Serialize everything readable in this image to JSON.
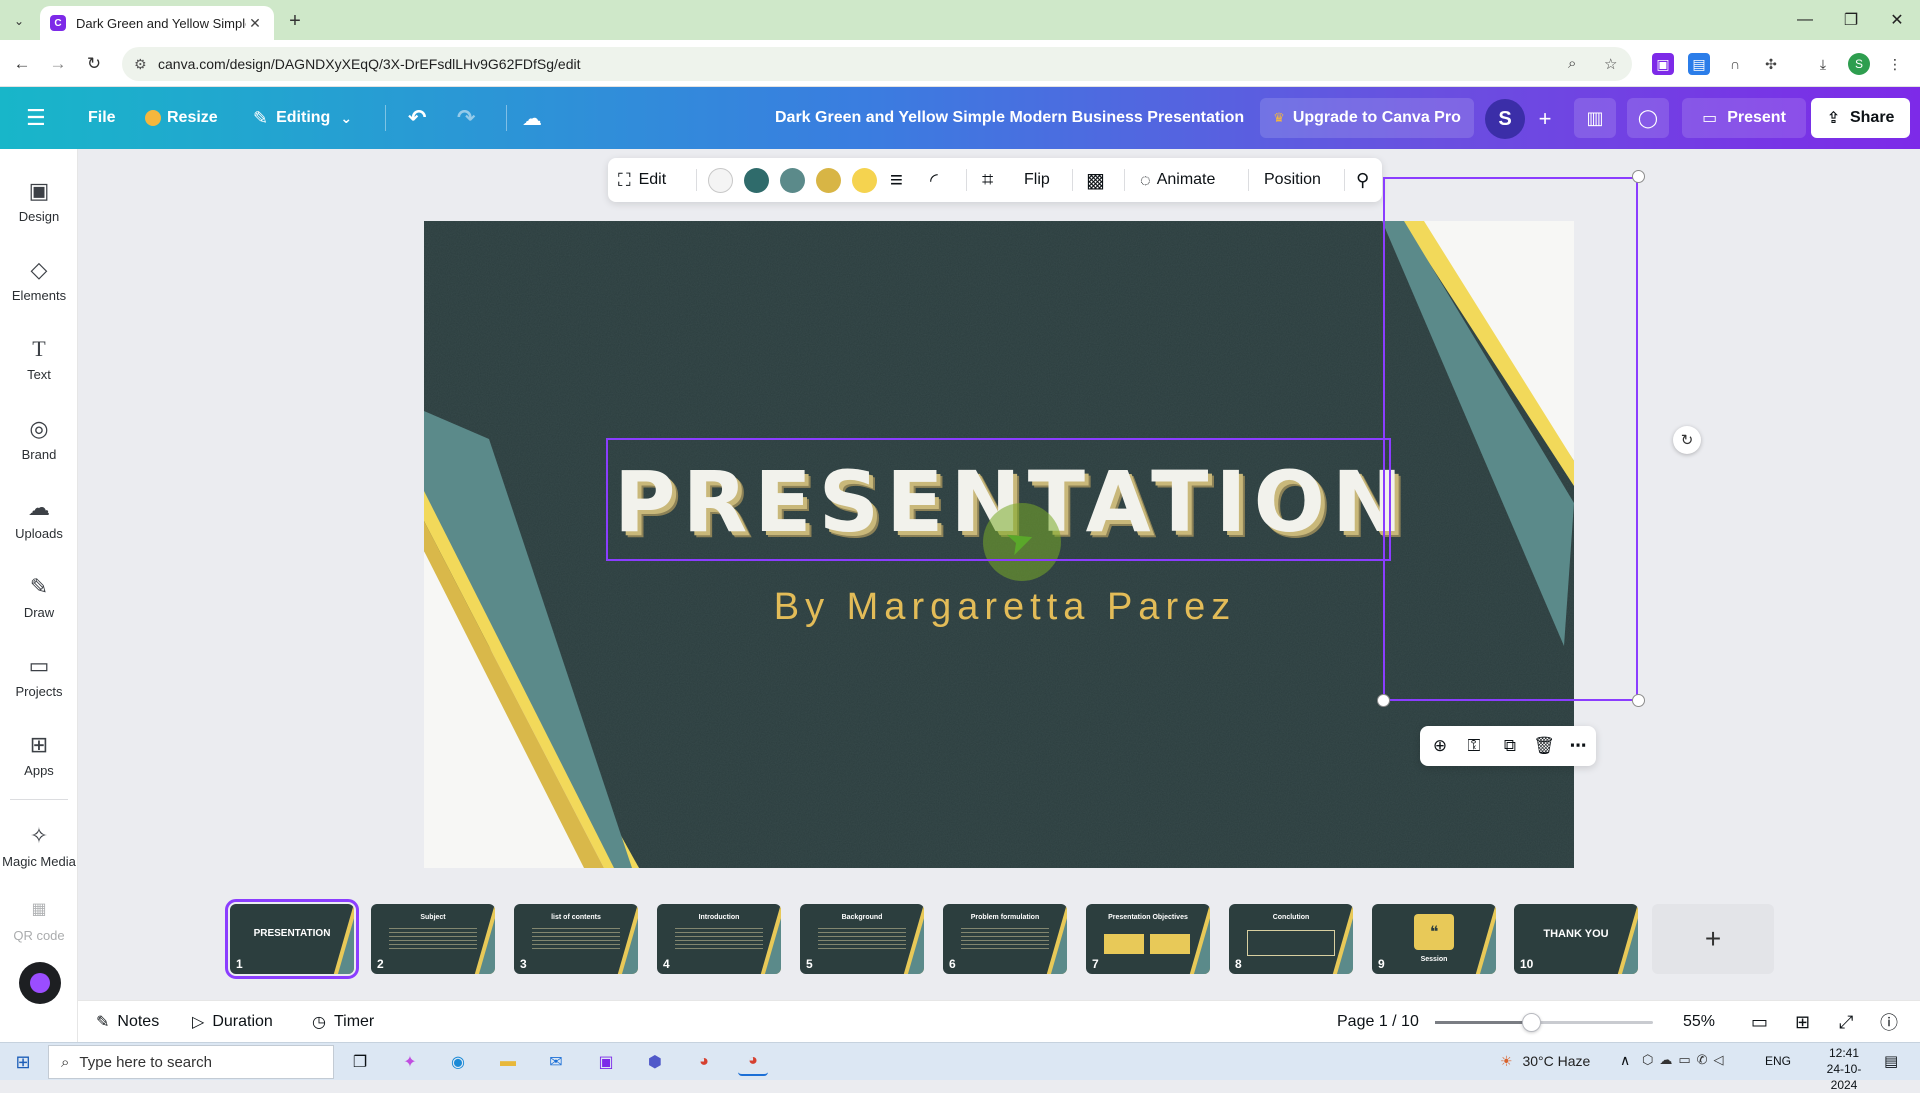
{
  "browser": {
    "tab_title": "Dark Green and Yellow Simple M",
    "url": "canva.com/design/DAGNDXyXEqQ/3X-DrEFsdlLHv9G62FDfSg/edit",
    "profile_initial": "S"
  },
  "header": {
    "file_label": "File",
    "resize_label": "Resize",
    "editing_label": "Editing",
    "doc_title": "Dark Green and Yellow Simple Modern Business Presentation",
    "upgrade_label": "Upgrade to Canva Pro",
    "avatar_initial": "S",
    "present_label": "Present",
    "share_label": "Share"
  },
  "rail": {
    "items": [
      {
        "label": "Design",
        "icon": "design-icon"
      },
      {
        "label": "Elements",
        "icon": "elements-icon"
      },
      {
        "label": "Text",
        "icon": "text-icon"
      },
      {
        "label": "Brand",
        "icon": "brand-icon"
      },
      {
        "label": "Uploads",
        "icon": "uploads-icon"
      },
      {
        "label": "Draw",
        "icon": "draw-icon"
      },
      {
        "label": "Projects",
        "icon": "projects-icon"
      },
      {
        "label": "Apps",
        "icon": "apps-icon"
      },
      {
        "label": "Magic Media",
        "icon": "magic-media-icon"
      },
      {
        "label": "QR code",
        "icon": "qr-code-icon"
      }
    ]
  },
  "toolbar": {
    "edit_label": "Edit",
    "colors": [
      "#f4f4f4",
      "#2f6b6b",
      "#5b8a8a",
      "#d8b545",
      "#f5d34f"
    ],
    "flip_label": "Flip",
    "animate_label": "Animate",
    "position_label": "Position"
  },
  "slide": {
    "title": "PRESENTATION",
    "subtitle": "By Margaretta Parez",
    "bg_color": "#2b3d3e",
    "accent_yellow": "#f2d95a",
    "accent_teal": "#5b8a8a",
    "accent_gold": "#d9b84a"
  },
  "filmstrip": [
    {
      "n": "1",
      "title": "PRESENTATION"
    },
    {
      "n": "2",
      "title": "Subject"
    },
    {
      "n": "3",
      "title": "list of contents"
    },
    {
      "n": "4",
      "title": "Introduction"
    },
    {
      "n": "5",
      "title": "Background"
    },
    {
      "n": "6",
      "title": "Problem formulation"
    },
    {
      "n": "7",
      "title": "Presentation Objectives"
    },
    {
      "n": "8",
      "title": "Conclution"
    },
    {
      "n": "9",
      "title": "Session"
    },
    {
      "n": "10",
      "title": "THANK YOU"
    }
  ],
  "footer": {
    "notes_label": "Notes",
    "duration_label": "Duration",
    "timer_label": "Timer",
    "page_label": "Page 1 / 10",
    "zoom_label": "55%",
    "zoom_fraction": 0.44
  },
  "taskbar": {
    "search_placeholder": "Type here to search",
    "weather": "30°C  Haze",
    "lang": "ENG",
    "time": "12:41",
    "date": "24-10-2024"
  }
}
